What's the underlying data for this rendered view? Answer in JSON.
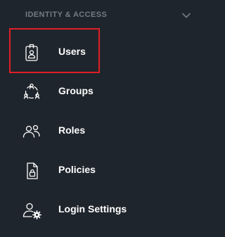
{
  "section": {
    "title": "IDENTITY & ACCESS",
    "collapse_icon": "chevron-down-icon"
  },
  "nav": {
    "items": [
      {
        "label": "Users",
        "icon": "user-badge-icon",
        "highlighted": true
      },
      {
        "label": "Groups",
        "icon": "group-cycle-icon",
        "highlighted": false
      },
      {
        "label": "Roles",
        "icon": "roles-icon",
        "highlighted": false
      },
      {
        "label": "Policies",
        "icon": "policy-document-icon",
        "highlighted": false
      },
      {
        "label": "Login Settings",
        "icon": "user-settings-icon",
        "highlighted": false
      }
    ]
  },
  "colors": {
    "background": "#1f252c",
    "text": "#ffffff",
    "muted": "#737b84",
    "highlight": "#e01f26"
  }
}
